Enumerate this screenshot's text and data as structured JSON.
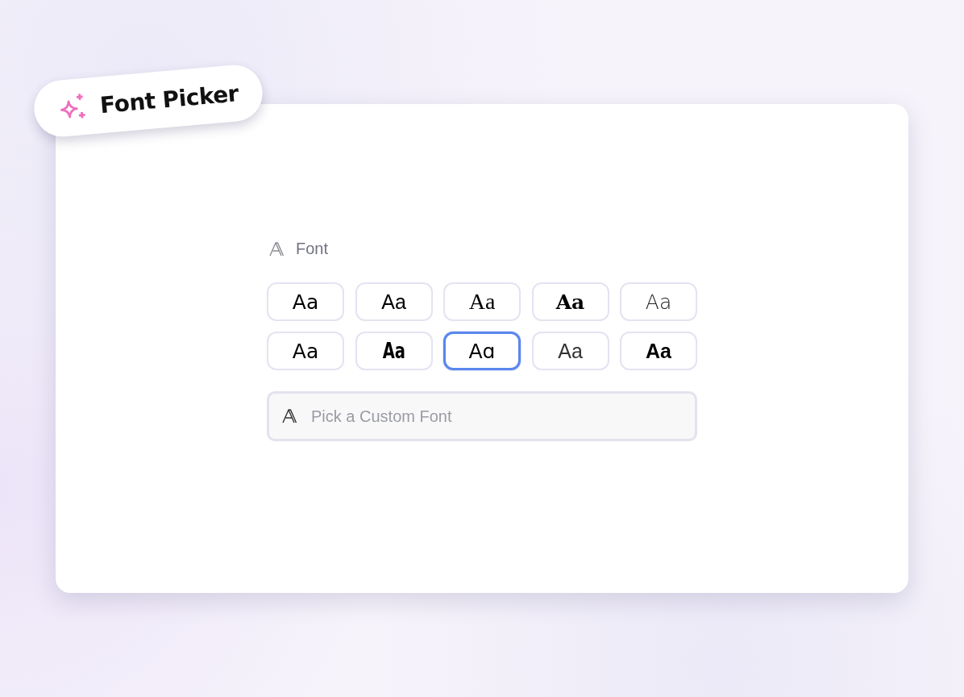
{
  "badge": {
    "title": "Font Picker"
  },
  "font_section": {
    "label": "Font",
    "options": [
      {
        "sample": "Aa",
        "kind": "sans",
        "selected": false
      },
      {
        "sample": "Aa",
        "kind": "humanist",
        "selected": false
      },
      {
        "sample": "Aa",
        "kind": "serif",
        "selected": false
      },
      {
        "sample": "Aa",
        "kind": "serif-bold",
        "selected": false
      },
      {
        "sample": "Aa",
        "kind": "light",
        "selected": false
      },
      {
        "sample": "Aa",
        "kind": "sans",
        "selected": false
      },
      {
        "sample": "Aa",
        "kind": "condensed",
        "selected": false
      },
      {
        "sample": "Aɑ",
        "kind": "geometric",
        "selected": true
      },
      {
        "sample": "Aa",
        "kind": "thin",
        "selected": false
      },
      {
        "sample": "Aa",
        "kind": "bold",
        "selected": false
      }
    ],
    "custom_field": {
      "placeholder": "Pick a Custom Font"
    }
  }
}
